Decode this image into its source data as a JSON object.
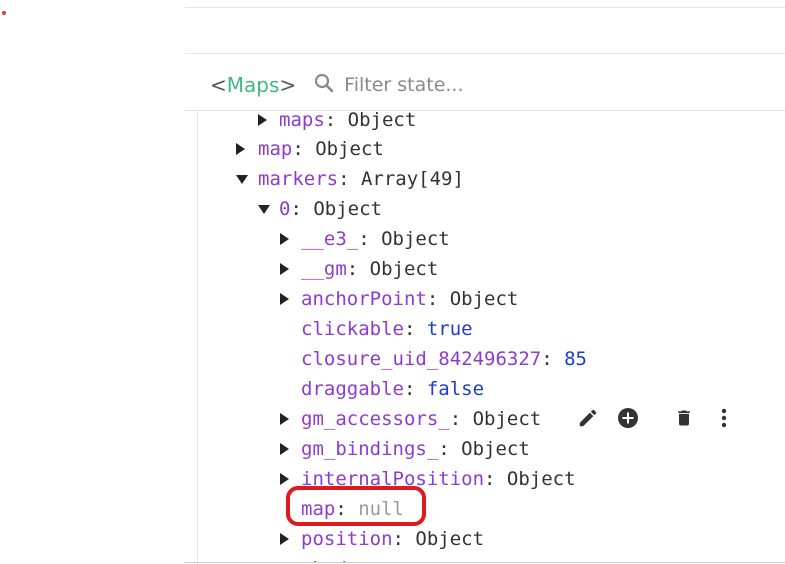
{
  "header": {
    "component_prefix": "<",
    "component_name": "Maps",
    "component_suffix": ">",
    "filter_placeholder": "Filter state..."
  },
  "tree": [
    {
      "key": "maps",
      "sep": ": ",
      "value": "Object",
      "type": "str",
      "expander": "collapsed"
    },
    {
      "key": "map",
      "sep": ": ",
      "value": "Object",
      "type": "str",
      "expander": "collapsed"
    },
    {
      "key": "markers",
      "sep": ": ",
      "value": "Array[49]",
      "type": "str",
      "expander": "expanded"
    },
    {
      "key": "0",
      "sep": ": ",
      "value": "Object",
      "type": "str",
      "expander": "expanded"
    },
    {
      "key": "__e3_",
      "sep": ": ",
      "value": "Object",
      "type": "str",
      "expander": "collapsed"
    },
    {
      "key": "__gm",
      "sep": ": ",
      "value": "Object",
      "type": "str",
      "expander": "collapsed"
    },
    {
      "key": "anchorPoint",
      "sep": ": ",
      "value": "Object",
      "type": "str",
      "expander": "collapsed"
    },
    {
      "key": "clickable",
      "sep": ": ",
      "value": "true",
      "type": "bool",
      "expander": "none"
    },
    {
      "key": "closure_uid_842496327",
      "sep": ": ",
      "value": "85",
      "type": "num",
      "expander": "none"
    },
    {
      "key": "draggable",
      "sep": ": ",
      "value": "false",
      "type": "bool",
      "expander": "none"
    },
    {
      "key": "gm_accessors_",
      "sep": ": ",
      "value": "Object",
      "type": "str",
      "expander": "collapsed"
    },
    {
      "key": "gm_bindings_",
      "sep": ": ",
      "value": "Object",
      "type": "str",
      "expander": "collapsed"
    },
    {
      "key": "internalPosition",
      "sep": ": ",
      "value": "Object",
      "type": "str",
      "expander": "collapsed"
    },
    {
      "key": "map",
      "sep": ": ",
      "value": "null",
      "type": "null",
      "expander": "none"
    },
    {
      "key": "position",
      "sep": ": ",
      "value": "Object",
      "type": "str",
      "expander": "collapsed"
    },
    {
      "key": "shadow",
      "sep": "",
      "value": "",
      "type": "str",
      "expander": "collapsed"
    }
  ],
  "row_actions": [
    {
      "name": "edit-icon",
      "label": "Edit value"
    },
    {
      "name": "add-circle-icon",
      "label": "Add"
    },
    {
      "name": "delete-icon",
      "label": "Remove"
    },
    {
      "name": "more-vert-icon",
      "label": "More"
    }
  ],
  "colors": {
    "key": "#8e3bd1",
    "literal": "#1a3ec8",
    "null": "#9a9a9a",
    "component_name": "#42b883",
    "annotation": "#e0191f"
  }
}
